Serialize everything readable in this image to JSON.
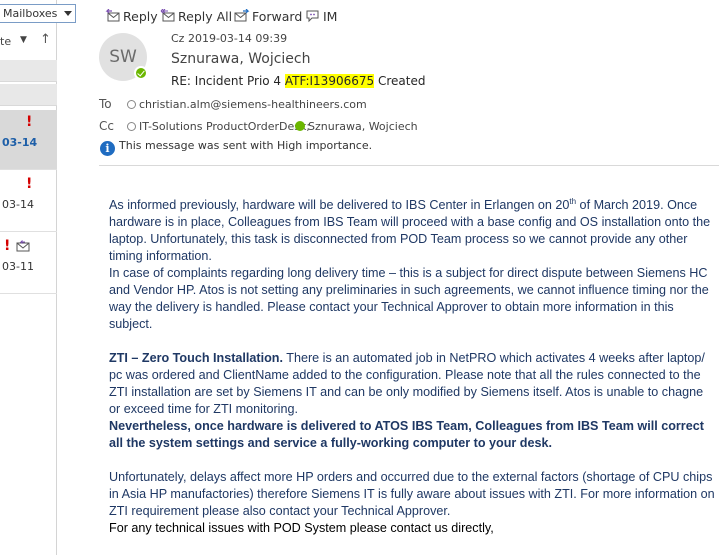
{
  "list_pane": {
    "mailbox_label": "Mailboxes",
    "sort_label": "te",
    "items": [
      {
        "date": "03-14",
        "flag": "!",
        "selected": true
      },
      {
        "date": "03-14",
        "flag": "!",
        "selected": false
      },
      {
        "date": "03-11",
        "flag": "!",
        "selected": false
      }
    ]
  },
  "toolbar": {
    "reply": "Reply",
    "reply_all": "Reply All",
    "forward": "Forward",
    "im": "IM"
  },
  "message": {
    "avatar_initials": "SW",
    "sent_date": "Cz 2019-03-14 09:39",
    "sender": "Sznurawa, Wojciech",
    "subject_prefix": "RE: Incident Prio 4 ",
    "subject_highlight": "ATF:I13906675",
    "subject_suffix": " Created",
    "to_label": "To",
    "to": [
      "christian.alm@siemens-healthineers.com"
    ],
    "cc_label": "Cc",
    "cc": [
      "IT-Solutions ProductOrderDesk;",
      "Sznurawa, Wojciech"
    ],
    "importance_note": "This message was sent with High importance."
  },
  "body": {
    "p1_a": "As informed previously, hardware will be delivered to IBS Center in Erlangen on 20",
    "p1_sup": "th",
    "p1_b": " of March 2019. Once hardware is in place, Colleagues from IBS Team will proceed with a base config and OS installation onto the laptop. Unfortunately, this task is disconnected from POD Team process so we cannot provide any other timing information.",
    "p2": "In case of complaints regarding long delivery time – this is a subject for direct dispute between Siemens HC and Vendor HP. Atos is not setting any preliminaries in such agreements, we cannot influence timing nor the way the delivery is handled. Please contact your Technical Approver to obtain more information in this subject.",
    "p3_bold": "ZTI – Zero Touch Installation.",
    "p3_rest": " There is an automated job in NetPRO which activates 4 weeks after laptop/ pc was ordered and ClientName added to the configuration. Please note that all the rules connected to the ZTI installation are set by Siemens IT and can be only modified by Siemens itself. Atos is unable to chagne or exceed time for ZTI monitoring.",
    "p4_bold": "Nevertheless, once hardware is delivered to ATOS IBS Team, Colleagues from IBS Team will correct all the system settings and service a fully-working computer to your desk.",
    "p5": "Unfortunately, delays affect more HP orders and occurred due to the external factors (shortage of CPU chips in Asia HP manufactories) therefore Siemens IT is fully aware about issues with ZTI. For more information on ZTI requirement please also contact your Technical Approver.",
    "p6": "For any technical issues with POD System please contact us directly,"
  }
}
